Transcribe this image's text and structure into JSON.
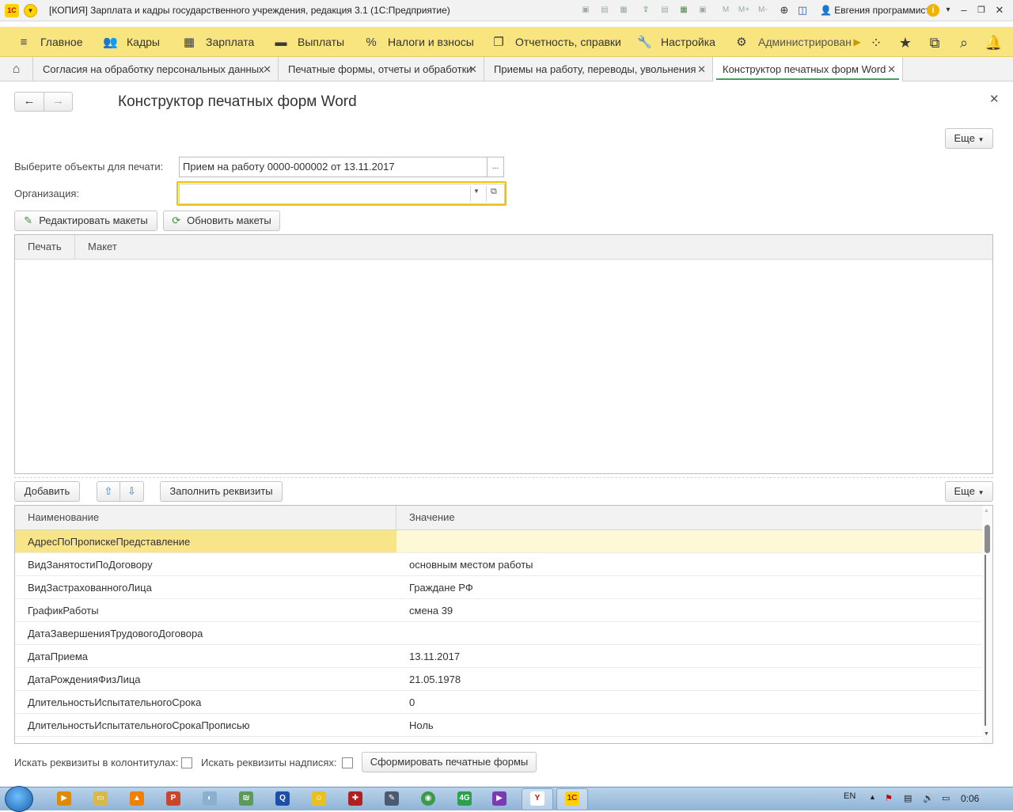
{
  "window": {
    "title": "[КОПИЯ] Зарплата и кадры государственного учреждения, редакция 3.1  (1С:Предприятие)",
    "logo": "1С",
    "user": "Евгения программист",
    "toolbar_icons": [
      "save-icon",
      "print-icon",
      "preview-icon",
      "export-icon",
      "document-icon",
      "spreadsheet-icon",
      "calendar-icon",
      "memory-m-icon",
      "memory-plus-icon",
      "memory-minus-icon",
      "zoom-icon",
      "panel-icon"
    ],
    "memory_labels": [
      "M",
      "M+",
      "M-"
    ]
  },
  "main_menu": {
    "items": [
      {
        "label": "Главное",
        "icon": "menu-lines-icon"
      },
      {
        "label": "Кадры",
        "icon": "people-icon"
      },
      {
        "label": "Зарплата",
        "icon": "calculator-icon"
      },
      {
        "label": "Выплаты",
        "icon": "wallet-icon"
      },
      {
        "label": "Налоги и взносы",
        "icon": "percent-icon"
      },
      {
        "label": "Отчетность, справки",
        "icon": "reports-icon"
      },
      {
        "label": "Настройка",
        "icon": "wrench-icon"
      },
      {
        "label": "Администрирован",
        "icon": "gear-icon"
      }
    ]
  },
  "tabs": [
    {
      "label": "Согласия на обработку персональных данных"
    },
    {
      "label": "Печатные формы, отчеты и обработки"
    },
    {
      "label": "Приемы на работу, переводы, увольнения"
    },
    {
      "label": "Конструктор печатных форм Word"
    }
  ],
  "form": {
    "title": "Конструктор печатных форм Word",
    "more_label": "Еще",
    "objects_label": "Выберите объекты для печати:",
    "objects_value": "Прием на работу 0000-000002 от 13.11.2017",
    "ellipsis": "...",
    "org_label": "Организация:",
    "org_value": "",
    "edit_templates": "Редактировать макеты",
    "refresh_templates": "Обновить макеты",
    "top_grid_columns": [
      "Печать",
      "Макет"
    ],
    "add_label": "Добавить",
    "fill_label": "Заполнить реквизиты",
    "bottom_more_label": "Еще",
    "columns": [
      "Наименование",
      "Значение"
    ],
    "rows": [
      {
        "name": "АдресПоПропискеПредставление",
        "value": ""
      },
      {
        "name": "ВидЗанятостиПоДоговору",
        "value": "основным местом работы"
      },
      {
        "name": "ВидЗастрахованногоЛица",
        "value": "Граждане РФ"
      },
      {
        "name": "ГрафикРаботы",
        "value": "смена 39"
      },
      {
        "name": "ДатаЗавершенияТрудовогоДоговора",
        "value": ""
      },
      {
        "name": "ДатаПриема",
        "value": "13.11.2017"
      },
      {
        "name": "ДатаРожденияФизЛица",
        "value": "21.05.1978"
      },
      {
        "name": "ДлительностьИспытательногоСрока",
        "value": "0"
      },
      {
        "name": "ДлительностьИспытательногоСрокаПрописью",
        "value": "Ноль"
      }
    ],
    "search_headers_label": "Искать реквизиты в колонтитулах:",
    "search_captions_label": "Искать реквизиты надписях:",
    "generate_label": "Сформировать печатные формы"
  },
  "taskbar": {
    "apps": [
      "media-icon",
      "explorer-icon",
      "vlc-icon",
      "powerpoint-icon",
      "tool-icon",
      "app-icon",
      "qip-icon",
      "messenger-icon",
      "game-icon",
      "editor-icon",
      "chrome-icon",
      "4g-icon",
      "player-icon",
      "yandex-icon",
      "1c-icon"
    ],
    "lang": "EN",
    "time": "0:06"
  },
  "colors": {
    "menu_bg": "#f9e580",
    "selected_row": "#f8e58a",
    "accent_green": "#3fa45a",
    "focus_border": "#f2c200"
  }
}
